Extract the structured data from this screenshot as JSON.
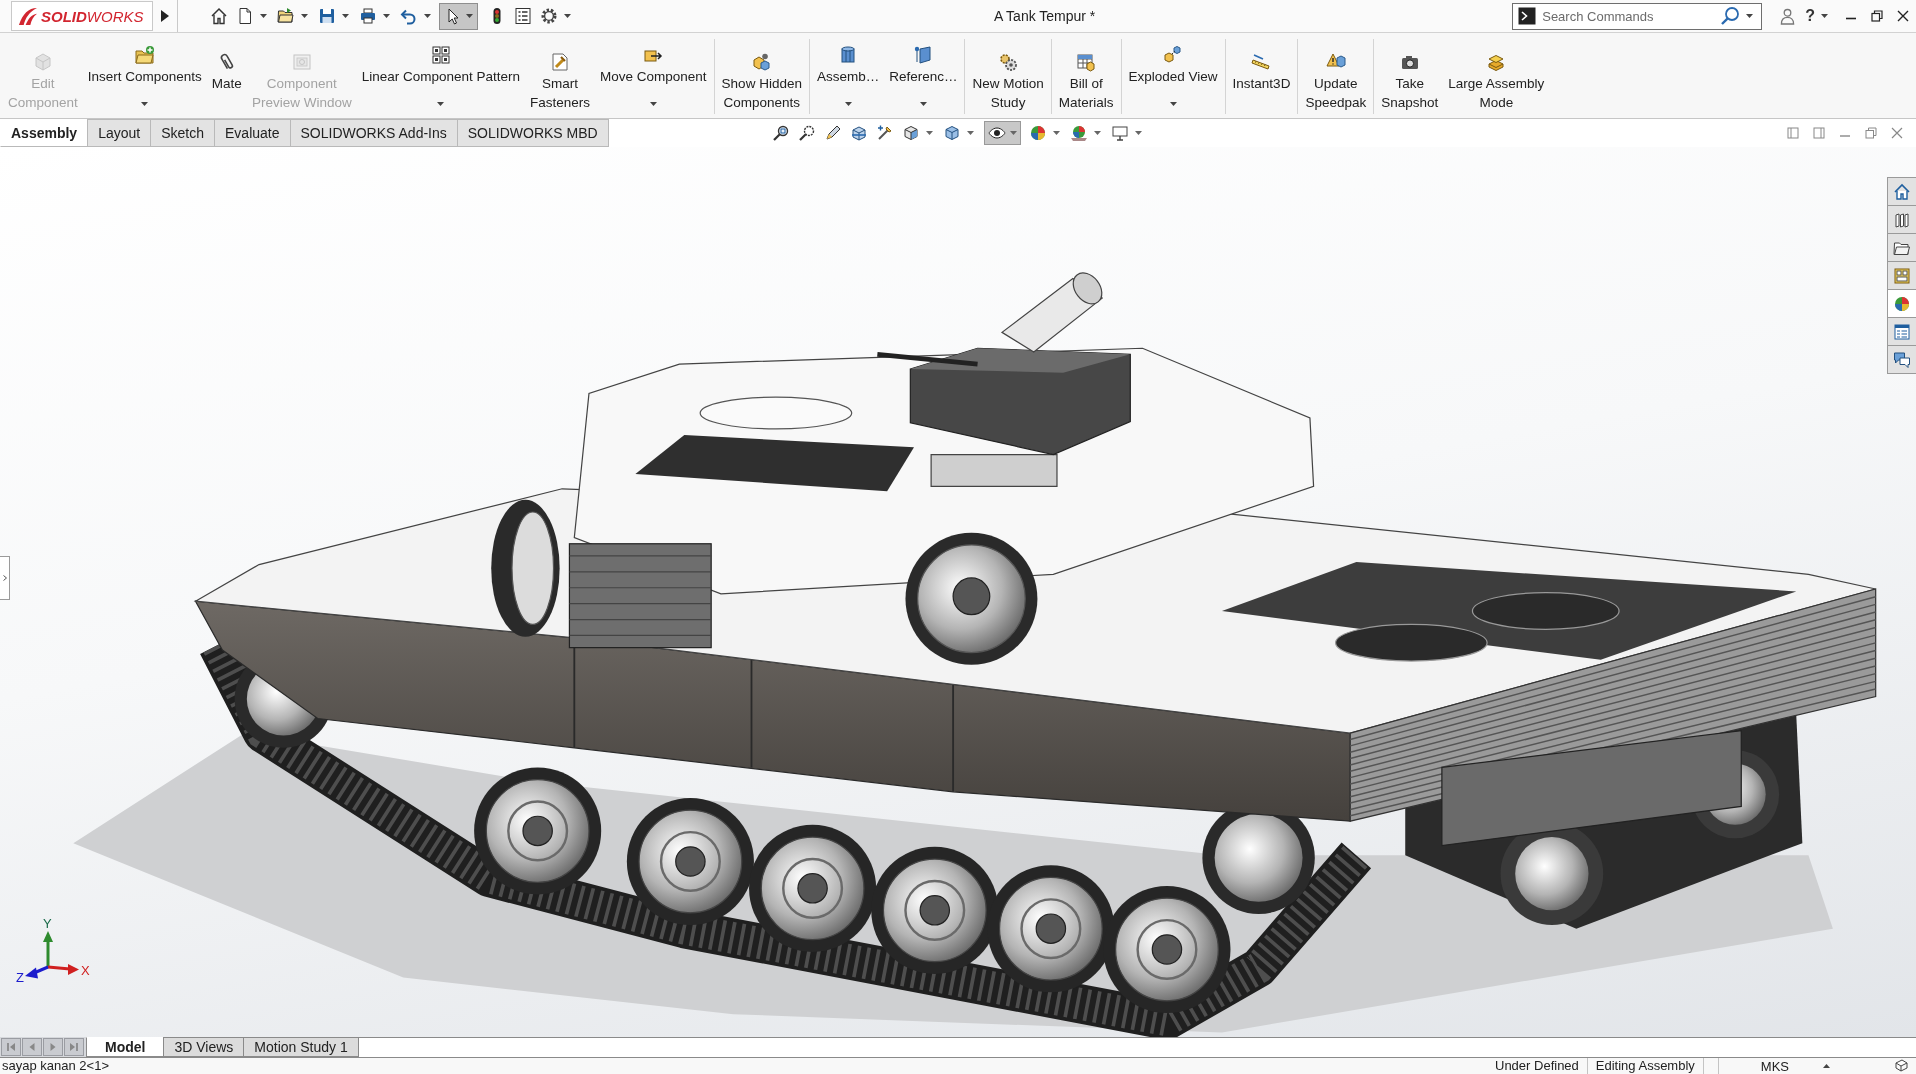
{
  "title_bar": {
    "logo": "**SOLID**WORKS",
    "select_tool": {
      "on": true
    },
    "title": "A Tank Tempur *",
    "search": {
      "placeholder": "Search Commands"
    },
    "help": "?"
  },
  "ribbon": {
    "groups": [
      {
        "items": [
          {
            "label": "Edit\nComponent",
            "disabled": true,
            "dropdown": false
          },
          {
            "label": "Insert Components",
            "disabled": false,
            "dropdown": true
          },
          {
            "label": "Mate",
            "disabled": false,
            "dropdown": false
          },
          {
            "label": "Component\nPreview Window",
            "disabled": true,
            "dropdown": false
          },
          {
            "label": "Linear Component Pattern",
            "disabled": false,
            "dropdown": true
          },
          {
            "label": "Smart\nFasteners",
            "disabled": false,
            "dropdown": false
          },
          {
            "label": "Move Component",
            "disabled": false,
            "dropdown": true
          }
        ]
      },
      {
        "items": [
          {
            "label": "Show Hidden\nComponents",
            "disabled": false,
            "dropdown": false
          }
        ]
      },
      {
        "items": [
          {
            "label": "Assemb…",
            "disabled": false,
            "dropdown": true
          },
          {
            "label": "Referenc…",
            "disabled": false,
            "dropdown": true
          }
        ]
      },
      {
        "items": [
          {
            "label": "New Motion\nStudy",
            "disabled": false,
            "dropdown": false
          }
        ]
      },
      {
        "items": [
          {
            "label": "Bill of\nMaterials",
            "disabled": false,
            "dropdown": false
          }
        ]
      },
      {
        "items": [
          {
            "label": "Exploded View",
            "disabled": false,
            "dropdown": true
          }
        ]
      },
      {
        "items": [
          {
            "label": "Instant3D",
            "disabled": false,
            "dropdown": false
          }
        ]
      },
      {
        "items": [
          {
            "label": "Update\nSpeedpak",
            "disabled": false,
            "dropdown": false
          }
        ]
      },
      {
        "items": [
          {
            "label": "Take\nSnapshot",
            "disabled": false,
            "dropdown": false
          },
          {
            "label": "Large Assembly\nMode",
            "disabled": false,
            "dropdown": false
          }
        ]
      }
    ]
  },
  "command_tabs": [
    {
      "label": "Assembly",
      "selected": true
    },
    {
      "label": "Layout",
      "selected": false
    },
    {
      "label": "Sketch",
      "selected": false
    },
    {
      "label": "Evaluate",
      "selected": false
    },
    {
      "label": "SOLIDWORKS Add-Ins",
      "selected": false
    },
    {
      "label": "SOLIDWORKS MBD",
      "selected": false
    }
  ],
  "view_toolbar": {
    "hide_show_items": {
      "on": true
    }
  },
  "task_pane": [
    {
      "selected": false
    },
    {
      "selected": false
    },
    {
      "selected": false
    },
    {
      "selected": false
    },
    {
      "selected": true
    },
    {
      "selected": false
    },
    {
      "selected": false
    }
  ],
  "triad": {
    "x": "X",
    "y": "Y",
    "z": "Z"
  },
  "bottom_tabs": [
    {
      "label": "Model",
      "selected": true
    },
    {
      "label": "3D Views",
      "selected": false
    },
    {
      "label": "Motion Study 1",
      "selected": false
    }
  ],
  "status_bar": {
    "selection": "sayap kanan 2<1>",
    "state": "Under Defined",
    "mode": "Editing Assembly",
    "units": "MKS"
  }
}
